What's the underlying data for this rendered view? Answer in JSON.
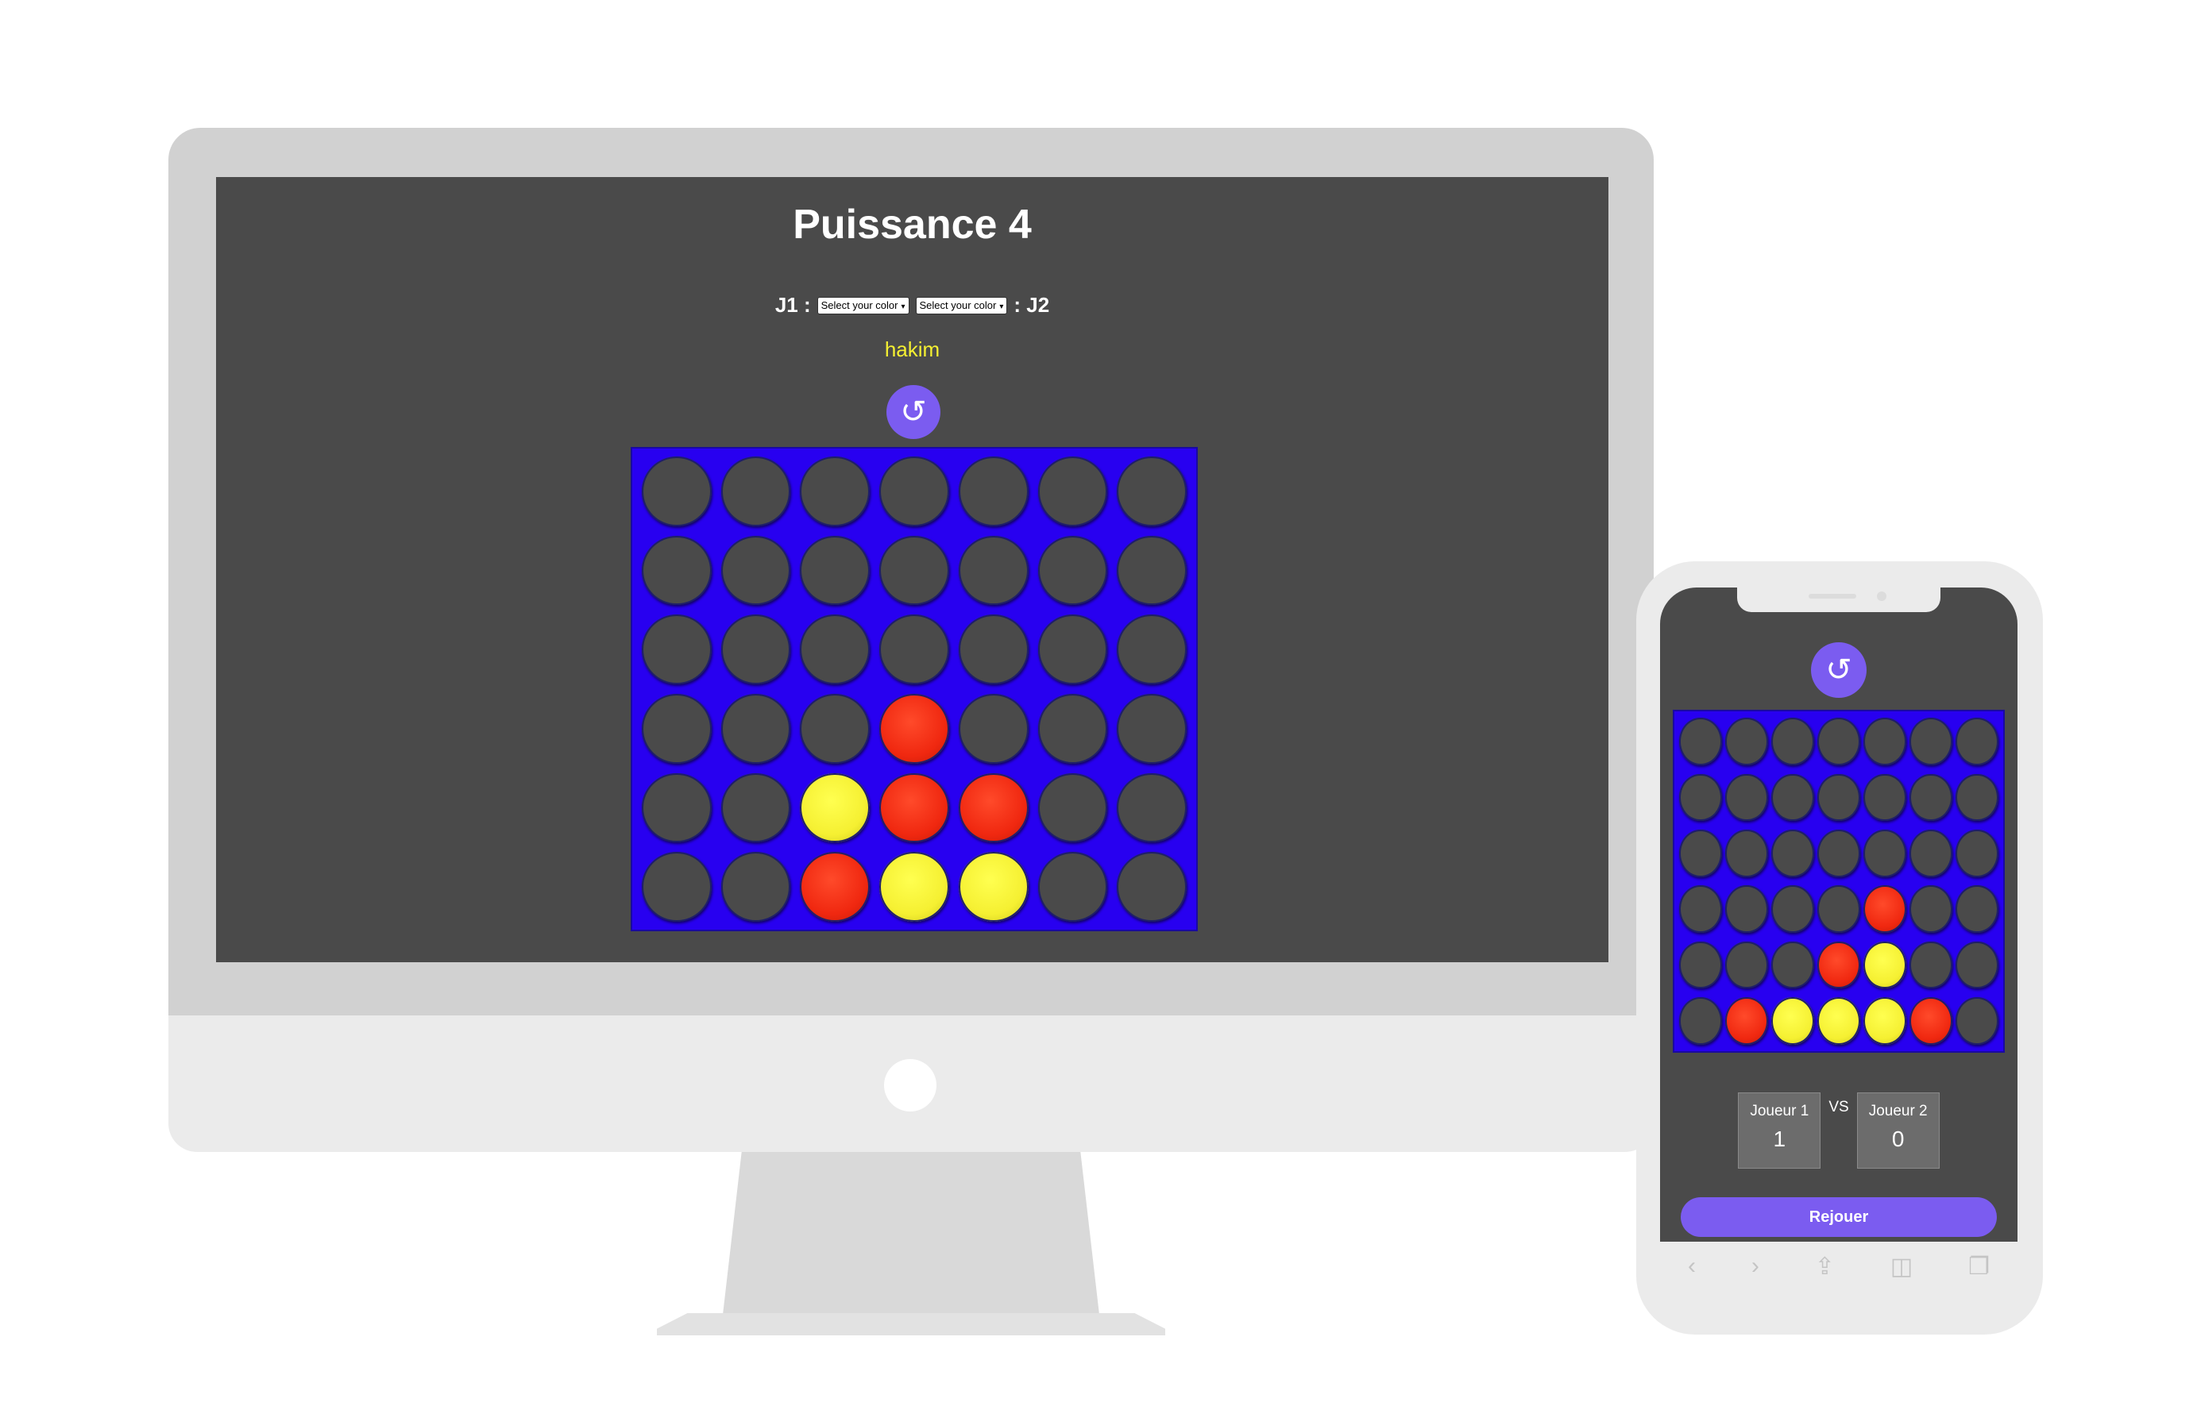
{
  "desktop": {
    "title": "Puissance 4",
    "player1_label": "J1 :",
    "player2_label": ": J2",
    "select1_value": "Select your color",
    "select2_value": "Select your color",
    "current_player": "hakim",
    "reset_icon": "↺",
    "board": [
      [
        "empty",
        "empty",
        "empty",
        "empty",
        "empty",
        "empty",
        "empty"
      ],
      [
        "empty",
        "empty",
        "empty",
        "empty",
        "empty",
        "empty",
        "empty"
      ],
      [
        "empty",
        "empty",
        "empty",
        "empty",
        "empty",
        "empty",
        "empty"
      ],
      [
        "empty",
        "empty",
        "empty",
        "red",
        "empty",
        "empty",
        "empty"
      ],
      [
        "empty",
        "empty",
        "yellow",
        "red",
        "red",
        "empty",
        "empty"
      ],
      [
        "empty",
        "empty",
        "red",
        "yellow",
        "yellow",
        "empty",
        "empty"
      ]
    ]
  },
  "mobile": {
    "reset_icon": "↺",
    "board": [
      [
        "empty",
        "empty",
        "empty",
        "empty",
        "empty",
        "empty",
        "empty"
      ],
      [
        "empty",
        "empty",
        "empty",
        "empty",
        "empty",
        "empty",
        "empty"
      ],
      [
        "empty",
        "empty",
        "empty",
        "empty",
        "empty",
        "empty",
        "empty"
      ],
      [
        "empty",
        "empty",
        "empty",
        "empty",
        "red",
        "empty",
        "empty"
      ],
      [
        "empty",
        "empty",
        "empty",
        "red",
        "yellow",
        "empty",
        "empty"
      ],
      [
        "empty",
        "red",
        "yellow",
        "yellow",
        "yellow",
        "red",
        "empty"
      ]
    ],
    "score": {
      "player1_label": "Joueur 1",
      "player1_score": "1",
      "vs": "VS",
      "player2_label": "Joueur 2",
      "player2_score": "0"
    },
    "rejouer_label": "Rejouer",
    "safari_icons": {
      "back": "‹",
      "forward": "›",
      "share": "⇪",
      "bookmarks": "◫",
      "tabs": "❐"
    }
  },
  "colors": {
    "screen_bg": "#4a4a4a",
    "board_blue": "#2800f0",
    "red_disc": "#f02810",
    "yellow_disc": "#f5f032",
    "accent_purple": "#7b5cf0"
  }
}
